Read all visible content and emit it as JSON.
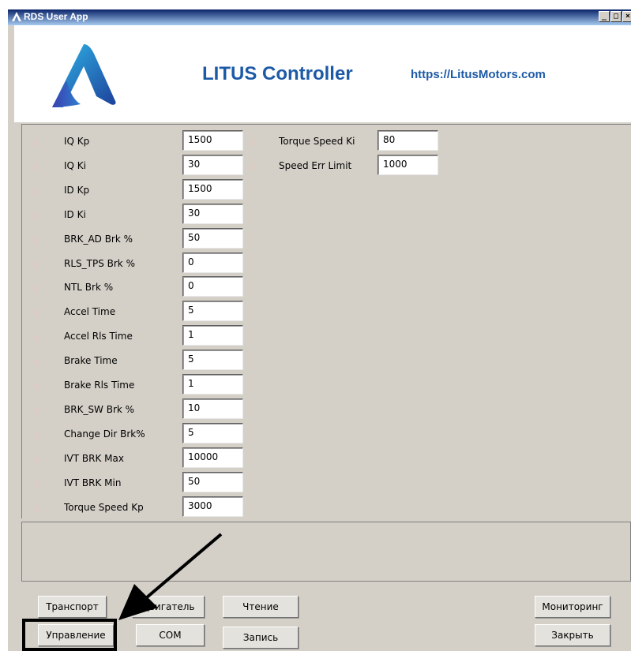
{
  "window": {
    "title": "RDS User App",
    "controls": [
      "_",
      "□",
      "×"
    ]
  },
  "header": {
    "app_name": "LITUS Controller",
    "url": "https://LitusMotors.com",
    "logo_icon": "litus-a-logo-icon"
  },
  "params_left": [
    {
      "label": "IQ Kp",
      "value": "1500"
    },
    {
      "label": "IQ Ki",
      "value": "30"
    },
    {
      "label": "ID Kp",
      "value": "1500"
    },
    {
      "label": "ID Ki",
      "value": "30"
    },
    {
      "label": "BRK_AD Brk %",
      "value": "50"
    },
    {
      "label": "RLS_TPS Brk %",
      "value": "0"
    },
    {
      "label": "NTL Brk %",
      "value": "0"
    },
    {
      "label": "Accel Time",
      "value": "5"
    },
    {
      "label": "Accel Rls Time",
      "value": "1"
    },
    {
      "label": "Brake Time",
      "value": "5"
    },
    {
      "label": "Brake Rls Time",
      "value": "1"
    },
    {
      "label": "BRK_SW Brk %",
      "value": "10"
    },
    {
      "label": "Change Dir Brk%",
      "value": "5"
    },
    {
      "label": "IVT BRK Max",
      "value": "10000"
    },
    {
      "label": "IVT BRK Min",
      "value": "50"
    },
    {
      "label": "Torque Speed Kp",
      "value": "3000"
    }
  ],
  "params_right": [
    {
      "label": "Torque Speed Ki",
      "value": "80"
    },
    {
      "label": "Speed Err Limit",
      "value": "1000"
    }
  ],
  "buttons": {
    "transport": "Транспорт",
    "engine": "Двигатель",
    "read": "Чтение",
    "monitoring": "Мониторинг",
    "control": "Управление",
    "com": "COM",
    "write": "Запись",
    "close": "Закрыть"
  },
  "annotation": {
    "arrow_color": "#000000",
    "highlight_color": "#000000"
  },
  "colors": {
    "brand_blue": "#1d5aa6",
    "titlebar_start": "#0a246a",
    "titlebar_end": "#a6caf0",
    "panel_gray": "#d4d0c8"
  }
}
